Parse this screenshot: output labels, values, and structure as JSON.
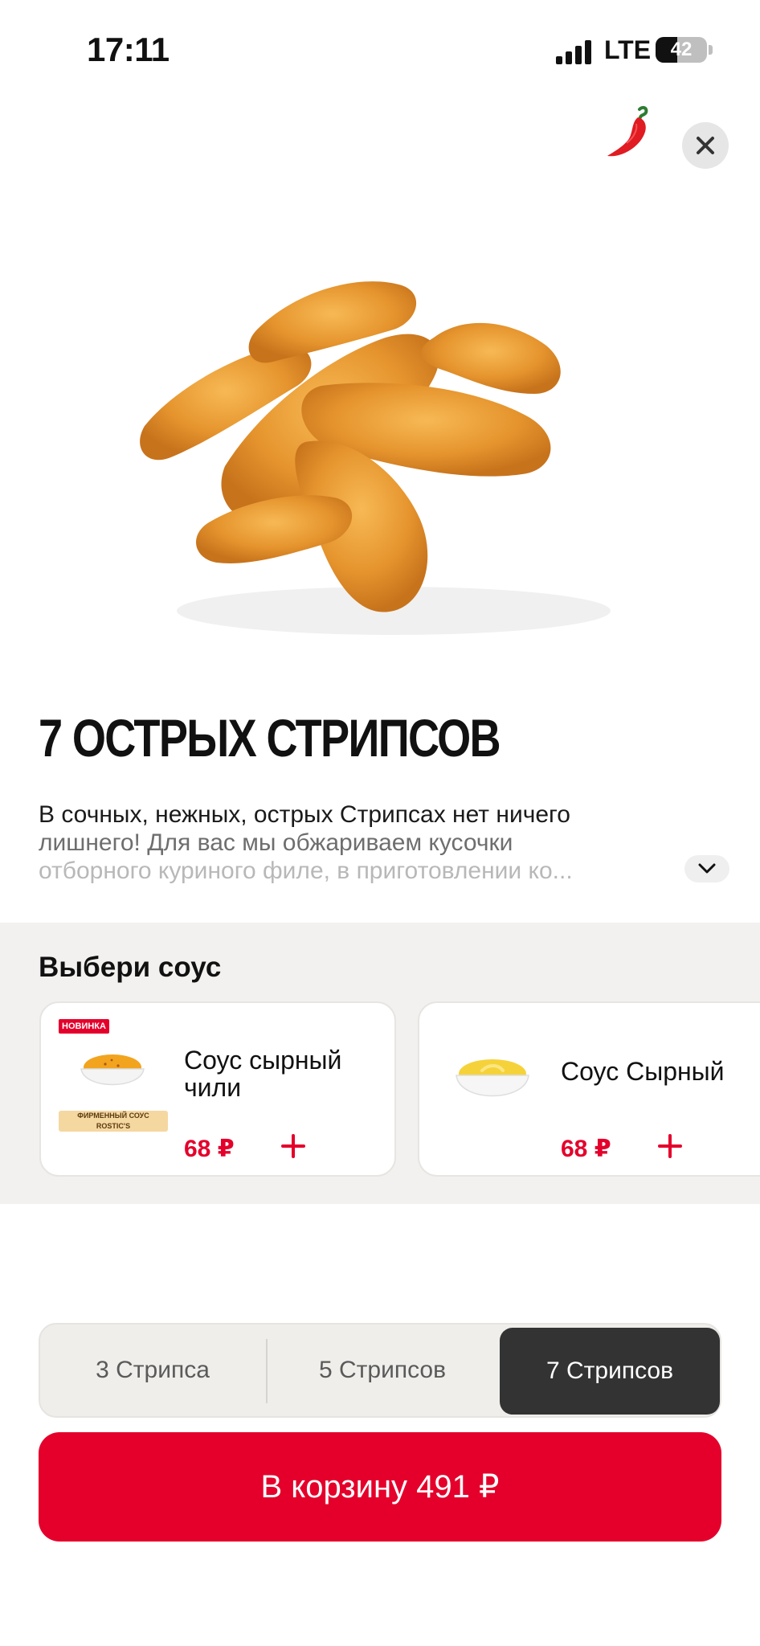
{
  "status_bar": {
    "time": "17:11",
    "network": "LTE",
    "battery": "42",
    "battery_level": 0.42
  },
  "header": {
    "spicy_icon": "chili-pepper-icon",
    "close_icon": "close-icon"
  },
  "product": {
    "title": "7 ОСТРЫХ СТРИПСОВ",
    "description_line1": "В сочных, нежных, острых Стрипсах нет ничего",
    "description_line2": "лишнего! Для вас мы обжариваем кусочки",
    "description_line3": "отборного куриного филе, в приготовлении ко...",
    "expand_icon": "chevron-down-icon"
  },
  "sauces": {
    "title": "Выбери соус",
    "items": [
      {
        "badge": "НОВИНКА",
        "brand_line1": "ФИРМЕННЫЙ СОУС",
        "brand_line2": "ROSTIC'S",
        "name": "Соус сырный чили",
        "price": "68 ₽",
        "add_icon": "plus-icon"
      },
      {
        "name": "Соус Сырный",
        "price": "68 ₽",
        "add_icon": "plus-icon"
      }
    ]
  },
  "size_selector": {
    "options": [
      "3 Стрипса",
      "5 Стрипсов",
      "7 Стрипсов"
    ],
    "selected": "7 Стрипсов"
  },
  "cta": {
    "label": "В корзину 491 ₽"
  },
  "colors": {
    "accent": "#e4002b",
    "selected_segment": "#333333",
    "section_bg": "#f2f1ef"
  }
}
